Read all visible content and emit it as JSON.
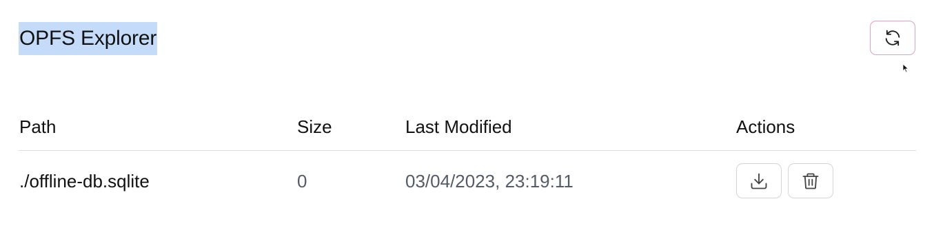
{
  "header": {
    "title": "OPFS Explorer",
    "refresh_icon": "refresh-icon"
  },
  "table": {
    "columns": [
      "Path",
      "Size",
      "Last Modified",
      "Actions"
    ],
    "rows": [
      {
        "path": "./offline-db.sqlite",
        "size": "0",
        "last_modified": "03/04/2023, 23:19:11",
        "actions": [
          "download-icon",
          "trash-icon"
        ]
      }
    ]
  },
  "colors": {
    "title_highlight": "#c4dcfa",
    "refresh_border": "#d9a3c4",
    "action_border": "#d4d4d8",
    "muted_text": "#555b66"
  }
}
